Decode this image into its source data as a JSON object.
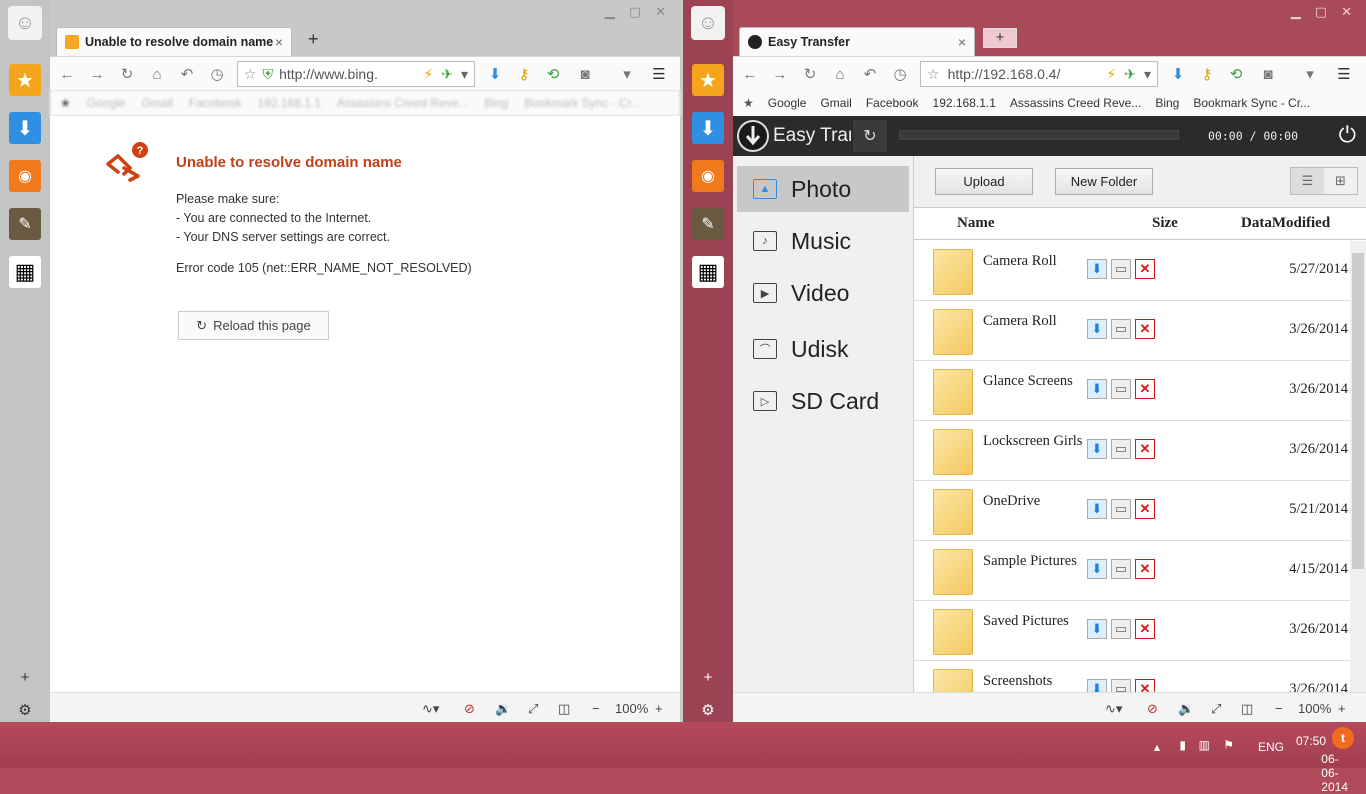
{
  "left_window": {
    "tab_title": "Unable to resolve domain name",
    "new_tab": "+",
    "url": "http://www.bing.",
    "bookmarks": [
      "Google",
      "Gmail",
      "Facebook",
      "192.168.1.1",
      "Assassins Creed Reve...",
      "Bing",
      "Bookmark Sync - Cr..."
    ],
    "error": {
      "title": "Unable to resolve domain name",
      "intro": "Please make sure:",
      "bullet1": "- You are connected to the Internet.",
      "bullet2": "- Your DNS server settings are correct.",
      "code": "Error code 105 (net::ERR_NAME_NOT_RESOLVED)",
      "reload_label": "Reload this page"
    },
    "zoom": "100%"
  },
  "right_window": {
    "tab_title": "Easy Transfer",
    "new_tab": "+",
    "url": "http://192.168.0.4/",
    "bookmarks": [
      "Google",
      "Gmail",
      "Facebook",
      "192.168.1.1",
      "Assassins Creed Reve...",
      "Bing",
      "Bookmark Sync - Cr..."
    ],
    "zoom": "100%",
    "app": {
      "title": "Easy Transfer",
      "time": "00:00 / 00:00",
      "categories": [
        "Photo",
        "Music",
        "Video",
        "Udisk",
        "SD Card"
      ],
      "upload_label": "Upload",
      "new_folder_label": "New Folder",
      "columns": {
        "name": "Name",
        "size": "Size",
        "modified": "DataModified"
      },
      "files": [
        {
          "name": "Camera Roll",
          "date": "5/27/2014"
        },
        {
          "name": "Camera Roll",
          "date": "3/26/2014"
        },
        {
          "name": "Glance Screens",
          "date": "3/26/2014"
        },
        {
          "name": "Lockscreen Girls",
          "date": "3/26/2014"
        },
        {
          "name": "OneDrive",
          "date": "5/21/2014"
        },
        {
          "name": "Sample Pictures",
          "date": "4/15/2014"
        },
        {
          "name": "Saved Pictures",
          "date": "3/26/2014"
        },
        {
          "name": "Screenshots",
          "date": "3/26/2014"
        }
      ]
    }
  },
  "taskbar": {
    "language": "ENG",
    "time": "07:50",
    "date": "06-06-2014"
  },
  "colors": {
    "accent": "#a84a58",
    "error_title": "#c0401a",
    "taskbar": "#a23e50"
  }
}
